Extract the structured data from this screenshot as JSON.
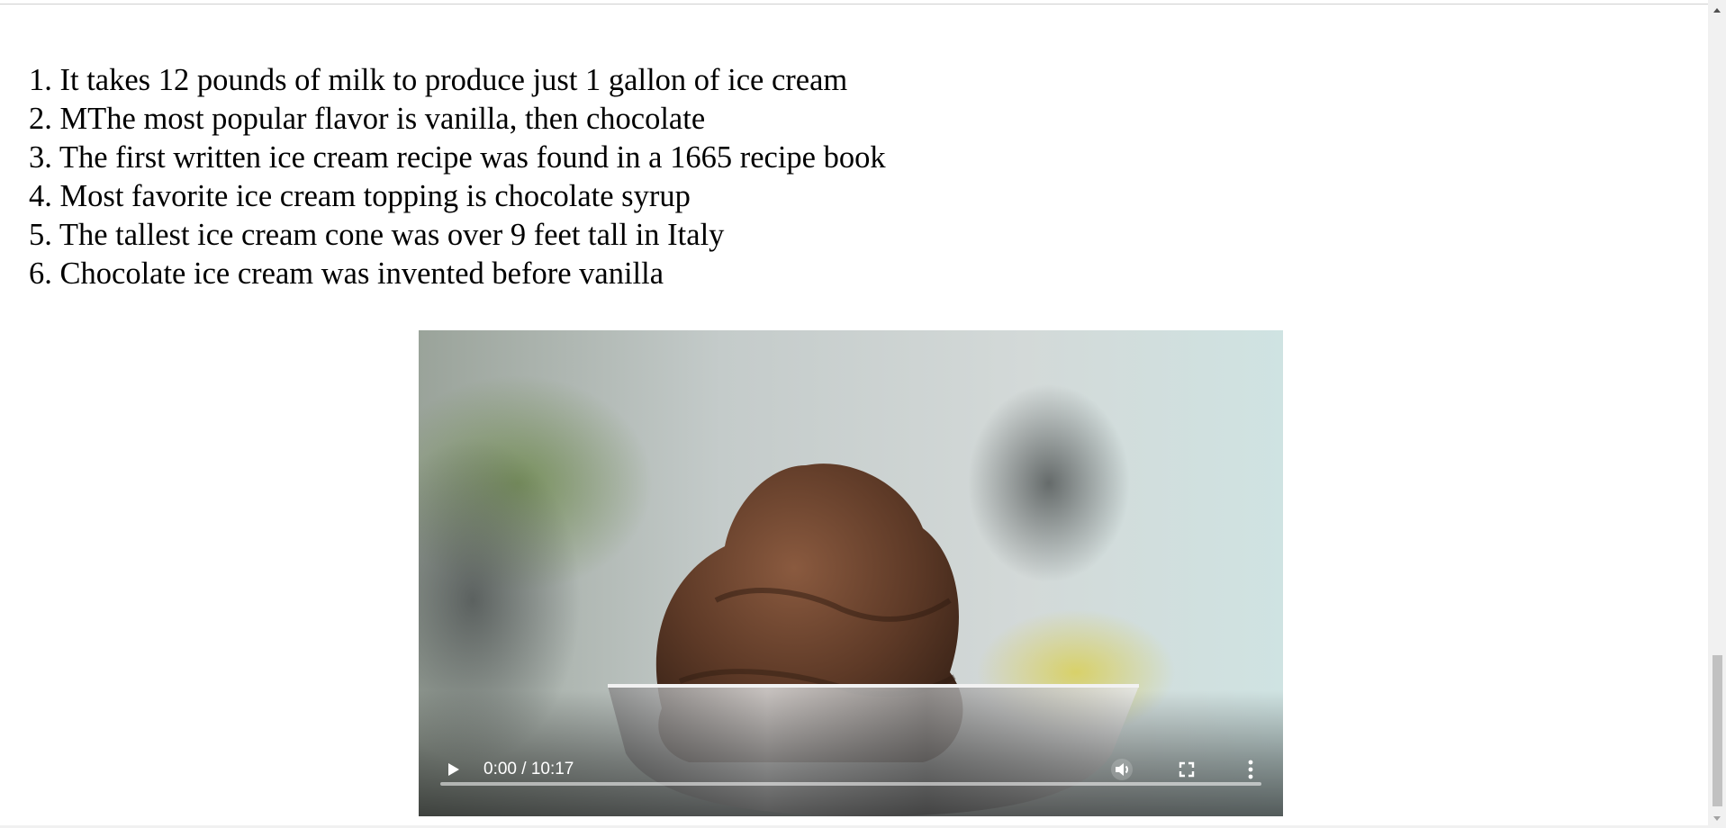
{
  "facts": [
    "1. It takes 12 pounds of milk to produce just 1 gallon of ice cream",
    "2. MThe most popular flavor is vanilla, then chocolate",
    "3. The first written ice cream recipe was found in a 1665 recipe book",
    "4. Most favorite ice cream topping is chocolate syrup",
    "5. The tallest ice cream cone was over 9 feet tall in Italy",
    "6. Chocolate ice cream was invented before vanilla"
  ],
  "video": {
    "time_display": "0:00 / 10:17",
    "progress": 0,
    "icons": {
      "play": "play-icon",
      "mute": "volume-icon",
      "fullscreen": "fullscreen-icon",
      "more": "more-options-icon"
    }
  },
  "scrollbar": {
    "up_icon": "scroll-up-arrow-icon",
    "down_icon": "scroll-down-arrow-icon"
  }
}
